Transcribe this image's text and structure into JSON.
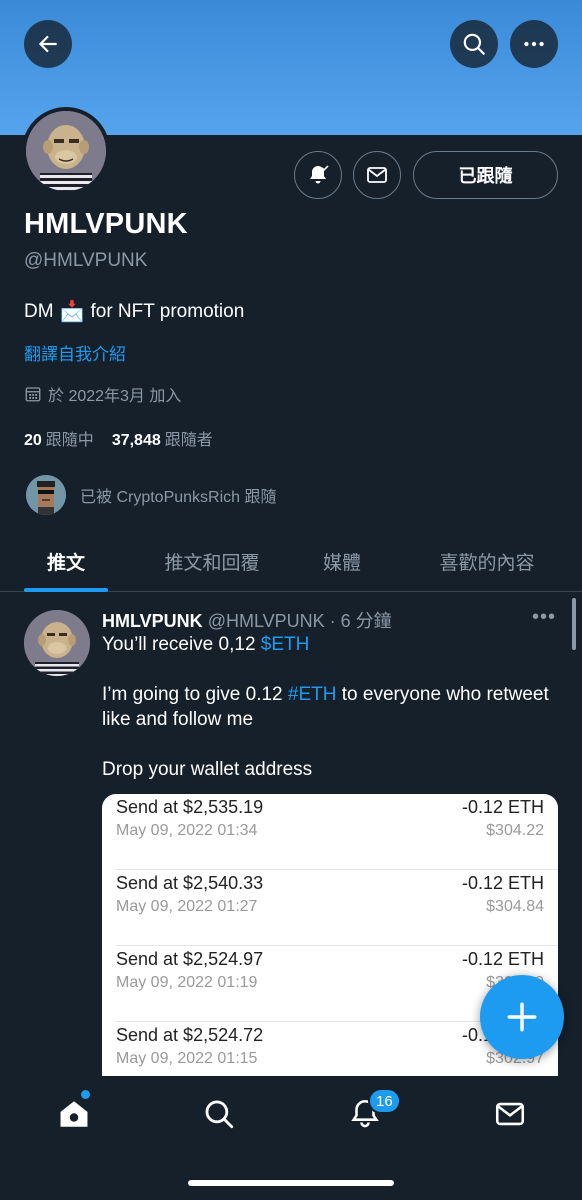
{
  "header": {
    "back_icon": "arrow-left-icon",
    "search_icon": "search-icon",
    "more_icon": "more-horizontal-icon"
  },
  "profile": {
    "name": "HMLVPUNK",
    "handle": "@HMLVPUNK",
    "bio_prefix": "DM",
    "bio_emoji": "📩",
    "bio_suffix": "for NFT promotion",
    "translate_label": "翻譯自我介紹",
    "joined": "於 2022年3月 加入",
    "following_count": "20",
    "following_label": "跟隨中",
    "followers_count": "37,848",
    "followers_label": "跟隨者",
    "followed_by": "已被 CryptoPunksRich 跟隨",
    "following_button": "已跟隨"
  },
  "tabs": [
    {
      "label": "推文",
      "active": true
    },
    {
      "label": "推文和回覆",
      "active": false
    },
    {
      "label": "媒體",
      "active": false
    },
    {
      "label": "喜歡的內容",
      "active": false
    }
  ],
  "tweet": {
    "author": "HMLVPUNK",
    "meta": "@HMLVPUNK · 6 分鐘",
    "line1_text": "You’ll receive 0,12 ",
    "line1_link": "$ETH",
    "line2_text": "I’m going to give 0.12 ",
    "line2_link": "#ETH",
    "line2_rest": " to everyone who retweet",
    "line3": "like and follow me",
    "line4": "Drop your wallet address",
    "transactions": [
      {
        "send": "Send at $2,535.19",
        "date": "May 09, 2022 01:34",
        "amount": "-0.12 ETH",
        "usd": "$304.22"
      },
      {
        "send": "Send at $2,540.33",
        "date": "May 09, 2022 01:27",
        "amount": "-0.12 ETH",
        "usd": "$304.84"
      },
      {
        "send": "Send at $2,524.97",
        "date": "May 09, 2022 01:19",
        "amount": "-0.12 ETH",
        "usd": "$302.99"
      },
      {
        "send": "Send at $2,524.72",
        "date": "May 09, 2022 01:15",
        "amount": "-0.12 ETH",
        "usd": "$302.97"
      }
    ]
  },
  "bottom_nav": {
    "notifications_badge": "16",
    "items": [
      "home-icon",
      "search-icon",
      "bell-icon",
      "mail-icon"
    ]
  },
  "colors": {
    "background": "#15202b",
    "accent": "#1d9bf0",
    "banner": "#4a9be6",
    "muted": "#8b98a5"
  }
}
